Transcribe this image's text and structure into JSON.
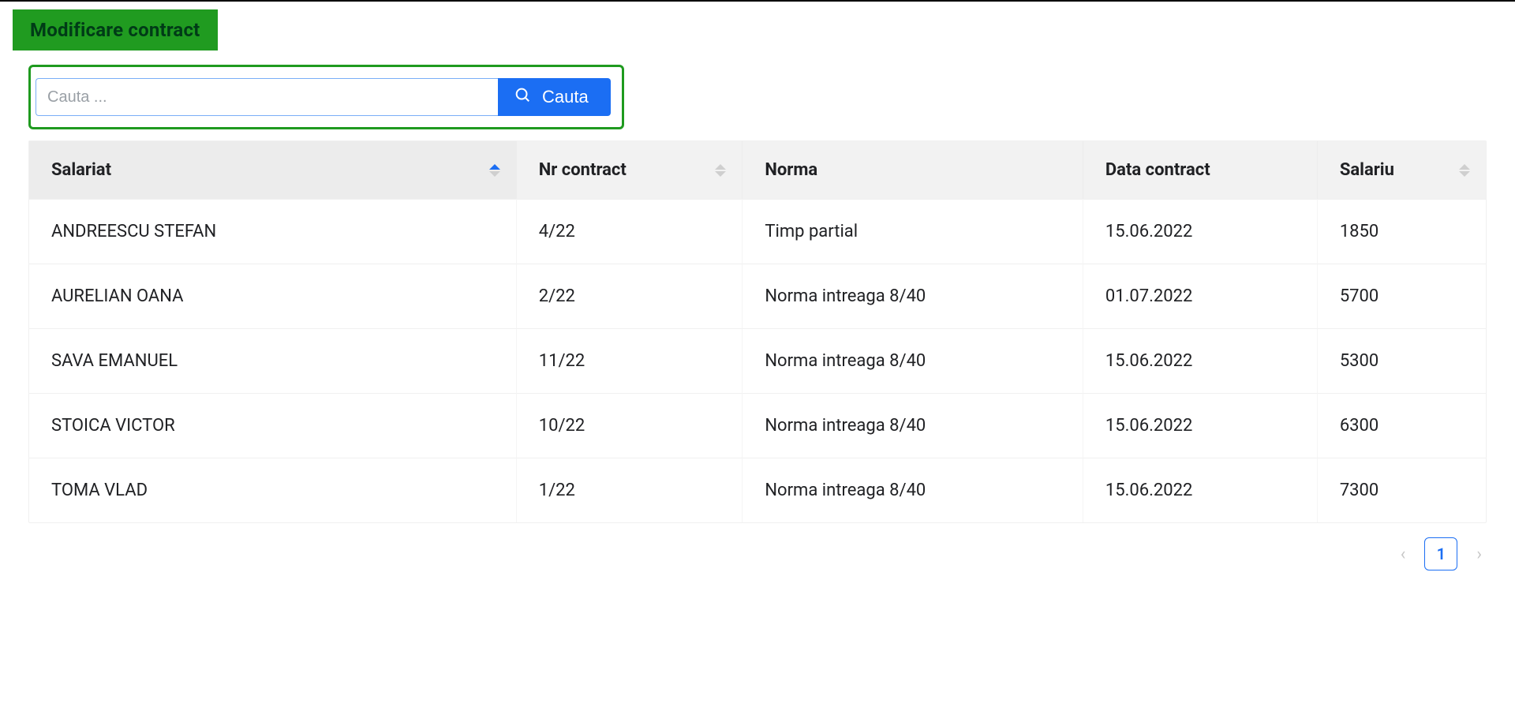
{
  "header": {
    "title": "Modificare contract"
  },
  "search": {
    "placeholder": "Cauta ...",
    "button_label": "Cauta",
    "value": ""
  },
  "table": {
    "columns": {
      "salariat": {
        "label": "Salariat",
        "sortable": true,
        "sort_dir": "asc"
      },
      "nrcontract": {
        "label": "Nr contract",
        "sortable": true,
        "sort_dir": "none"
      },
      "norma": {
        "label": "Norma",
        "sortable": false
      },
      "data": {
        "label": "Data contract",
        "sortable": false
      },
      "salariu": {
        "label": "Salariu",
        "sortable": true,
        "sort_dir": "none"
      }
    },
    "rows": [
      {
        "salariat": "ANDREESCU STEFAN",
        "nrcontract": "4/22",
        "norma": "Timp partial",
        "data": "15.06.2022",
        "salariu": "1850"
      },
      {
        "salariat": "AURELIAN OANA",
        "nrcontract": "2/22",
        "norma": "Norma intreaga 8/40",
        "data": "01.07.2022",
        "salariu": "5700"
      },
      {
        "salariat": "SAVA EMANUEL",
        "nrcontract": "11/22",
        "norma": "Norma intreaga 8/40",
        "data": "15.06.2022",
        "salariu": "5300"
      },
      {
        "salariat": "STOICA VICTOR",
        "nrcontract": "10/22",
        "norma": "Norma intreaga 8/40",
        "data": "15.06.2022",
        "salariu": "6300"
      },
      {
        "salariat": "TOMA VLAD",
        "nrcontract": "1/22",
        "norma": "Norma intreaga 8/40",
        "data": "15.06.2022",
        "salariu": "7300"
      }
    ]
  },
  "pagination": {
    "current": "1"
  }
}
